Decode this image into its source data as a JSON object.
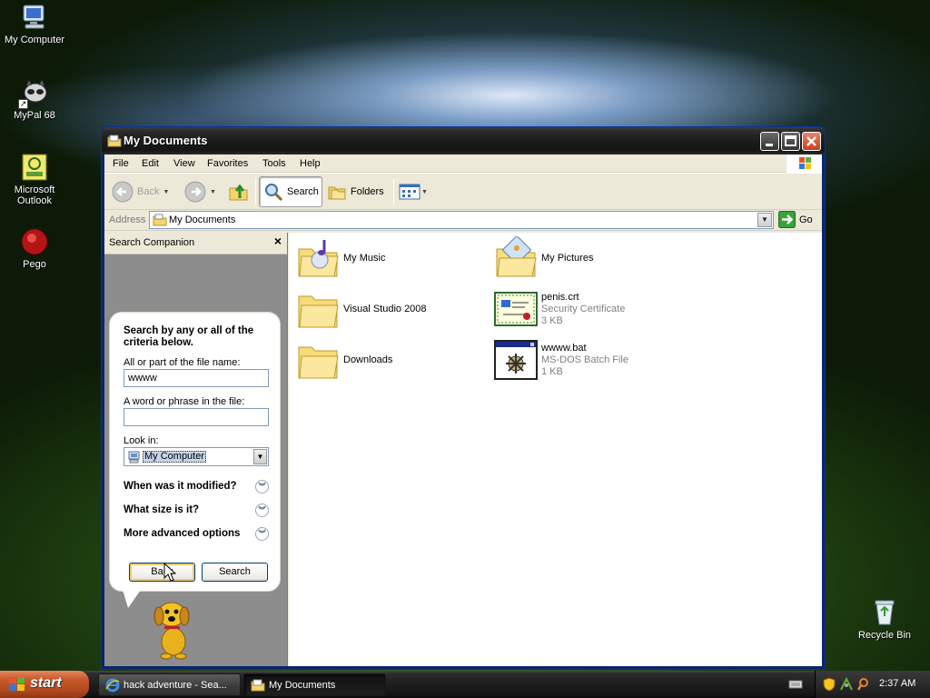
{
  "desktop": {
    "icons": [
      {
        "label": "My Computer",
        "icon": "my-computer-icon"
      },
      {
        "label": "MyPal 68",
        "icon": "mypal-icon"
      },
      {
        "label": "Microsoft Outlook",
        "icon": "outlook-icon"
      },
      {
        "label": "Pego",
        "icon": "pego-icon"
      },
      {
        "label": "Recycle Bin",
        "icon": "recycle-bin-icon"
      }
    ]
  },
  "window": {
    "title": "My Documents",
    "menu": [
      "File",
      "Edit",
      "View",
      "Favorites",
      "Tools",
      "Help"
    ],
    "toolbar": {
      "back": "Back",
      "search": "Search",
      "folders": "Folders"
    },
    "address": {
      "label": "Address",
      "value": "My Documents",
      "go": "Go"
    }
  },
  "search_companion": {
    "title": "Search Companion",
    "heading": "Search by any or all of the criteria below.",
    "filename_label": "All or part of the file name:",
    "filename_value": "wwww",
    "phrase_label": "A word or phrase in the file:",
    "phrase_value": "",
    "lookin_label": "Look in:",
    "lookin_value": "My Computer",
    "expanders": [
      "When was it modified?",
      "What size is it?",
      "More advanced options"
    ],
    "back_button": "Back",
    "search_button": "Search"
  },
  "files": [
    {
      "name": "My Music",
      "type": "",
      "size": "",
      "icon": "music-folder-icon"
    },
    {
      "name": "My Pictures",
      "type": "",
      "size": "",
      "icon": "pictures-folder-icon"
    },
    {
      "name": "Visual Studio 2008",
      "type": "",
      "size": "",
      "icon": "folder-icon"
    },
    {
      "name": "penis.crt",
      "type": "Security Certificate",
      "size": "3 KB",
      "icon": "certificate-icon"
    },
    {
      "name": "Downloads",
      "type": "",
      "size": "",
      "icon": "folder-icon"
    },
    {
      "name": "wwww.bat",
      "type": "MS-DOS Batch File",
      "size": "1 KB",
      "icon": "batch-file-icon"
    }
  ],
  "taskbar": {
    "start": "start",
    "tasks": [
      {
        "label": "hack adventure - Sea...",
        "icon": "internet-explorer-icon",
        "active": false
      },
      {
        "label": "My Documents",
        "icon": "folder-icon",
        "active": true
      }
    ],
    "clock": "2:37 AM"
  }
}
